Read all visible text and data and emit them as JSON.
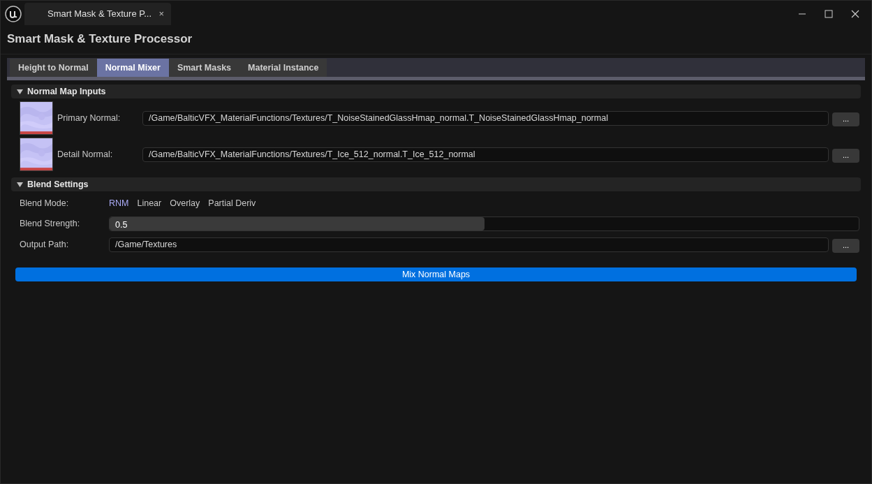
{
  "window": {
    "tab_title": "Smart Mask & Texture P...",
    "close_tab": "×"
  },
  "app_title": "Smart Mask & Texture Processor",
  "tabs": [
    {
      "label": "Height to Normal",
      "selected": false
    },
    {
      "label": "Normal Mixer",
      "selected": true
    },
    {
      "label": "Smart Masks",
      "selected": false
    },
    {
      "label": "Material Instance",
      "selected": false
    }
  ],
  "sections": [
    {
      "title": "Normal Map Inputs",
      "expanded": true,
      "kind": "inputs",
      "rows": [
        {
          "label": "Primary Normal:",
          "value": "/Game/BalticVFX_MaterialFunctions/Textures/T_NoiseStainedGlassHmap_normal.T_NoiseStainedGlassHmap_normal",
          "browse": "..."
        },
        {
          "label": "Detail Normal:",
          "value": "/Game/BalticVFX_MaterialFunctions/Textures/T_Ice_512_normal.T_Ice_512_normal",
          "browse": "..."
        }
      ]
    },
    {
      "title": "Blend Settings",
      "expanded": true,
      "kind": "settings",
      "rows": [
        {
          "kind": "options",
          "label": "Blend Mode:",
          "options": [
            {
              "label": "RNM",
              "selected": true
            },
            {
              "label": "Linear",
              "selected": false
            },
            {
              "label": "Overlay",
              "selected": false
            },
            {
              "label": "Partial Deriv",
              "selected": false
            }
          ]
        },
        {
          "kind": "slider",
          "label": "Blend Strength:",
          "value": "0.5",
          "level": 0.5
        },
        {
          "kind": "path",
          "label": "Output Path:",
          "value": "/Game/Textures",
          "browse": "..."
        }
      ]
    }
  ],
  "action_button": "Mix Normal Maps"
}
